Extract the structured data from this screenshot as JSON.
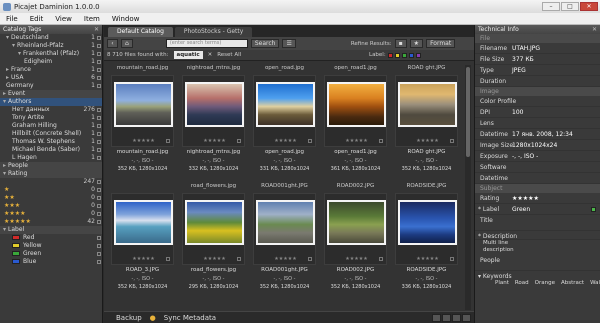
{
  "window": {
    "title": "Picajet Daminion 1.0.0.0"
  },
  "menu": [
    "File",
    "Edit",
    "View",
    "Item",
    "Window"
  ],
  "left_panel": {
    "header": "Catalog Tags",
    "tree": [
      {
        "label": "Deutschland",
        "count": "1",
        "indent": 1,
        "tri": "▾"
      },
      {
        "label": "Rheinland-Pfalz",
        "count": "1",
        "indent": 2,
        "tri": "▾"
      },
      {
        "label": "Frankenthal (Pfalz)",
        "count": "1",
        "indent": 3,
        "tri": "▾"
      },
      {
        "label": "Edigheim",
        "count": "1",
        "indent": 4,
        "tri": ""
      },
      {
        "label": "France",
        "count": "1",
        "indent": 1,
        "tri": "▸"
      },
      {
        "label": "USA",
        "count": "6",
        "indent": 1,
        "tri": "▸"
      },
      {
        "label": "Germany",
        "count": "1",
        "indent": 1,
        "tri": ""
      }
    ],
    "event_label": "Event",
    "authors_label": "Authors",
    "authors": [
      {
        "name": "Нет данных",
        "count": "276"
      },
      {
        "name": "Tony Artite",
        "count": "1"
      },
      {
        "name": "Graham Hilling",
        "count": "1"
      },
      {
        "name": "Hillbilt (Concrete Shell)",
        "count": "1"
      },
      {
        "name": "Thomas W. Stephens",
        "count": "1"
      },
      {
        "name": "Michael Benda (Saber)",
        "count": "1"
      },
      {
        "name": "L Hagen",
        "count": "1"
      }
    ],
    "people_label": "People",
    "rating_label": "Rating",
    "ratings": [
      {
        "stars": "",
        "count": "247"
      },
      {
        "stars": "★",
        "count": "0"
      },
      {
        "stars": "★★",
        "count": "0"
      },
      {
        "stars": "★★★",
        "count": "0"
      },
      {
        "stars": "★★★★",
        "count": "0"
      },
      {
        "stars": "★★★★★",
        "count": "42"
      }
    ],
    "label_header": "Label",
    "labels": [
      {
        "name": "Red",
        "color": "#d02a2a"
      },
      {
        "name": "Yellow",
        "color": "#e0cc2a"
      },
      {
        "name": "Green",
        "color": "#3aa83a"
      },
      {
        "name": "Blue",
        "color": "#2a5ad0"
      }
    ]
  },
  "center": {
    "tabs": [
      "Default Catalog",
      "PhotoStocks - Getty"
    ],
    "search_placeholder": "(enter search terms)",
    "search_button": "Search",
    "refine_label": "Refine Results:",
    "format_button": "Format",
    "files_found": "8 710 files found with:",
    "filter_chip": "aquatic",
    "reset_label": "Reset All",
    "label_caption": "Label:",
    "label_dots": [
      "#d02a2a",
      "#e0cc2a",
      "#3aa83a",
      "#2a5ad0",
      "#8a3ab0"
    ],
    "thumbnails": [
      {
        "top_name": "mountain_road.jpg",
        "name": "mountain_road.jpg",
        "meta": "-, -, ISO -",
        "size": "352 КБ, 1280x1024",
        "palette": "p1"
      },
      {
        "top_name": "nightroad_mtns.jpg",
        "name": "nightroad_mtns.jpg",
        "meta": "-, -, ISO -",
        "size": "332 КБ, 1280x1024",
        "palette": "p2"
      },
      {
        "top_name": "open_road.jpg",
        "name": "open_road.jpg",
        "meta": "-, -, ISO -",
        "size": "331 КБ, 1280x1024",
        "palette": "p3"
      },
      {
        "top_name": "open_road1.jpg",
        "name": "open_road1.jpg",
        "meta": "-, -, ISO -",
        "size": "361 КБ, 1280x1024",
        "palette": "p4"
      },
      {
        "top_name": "ROAD ght.JPG",
        "name": "ROAD ght.JPG",
        "meta": "-, -, ISO -",
        "size": "352 КБ, 1280x1024",
        "palette": "p5"
      },
      {
        "top_name": "",
        "name": "ROAD_3.JPG",
        "meta": "-, -, ISO -",
        "size": "352 КБ, 1280x1024",
        "palette": "p6"
      },
      {
        "top_name": "road_flowers.jpg",
        "name": "road_flowers.jpg",
        "meta": "-, -, ISO -",
        "size": "295 КБ, 1280x1024",
        "palette": "p7"
      },
      {
        "top_name": "ROAD001ght.JPG",
        "name": "ROAD001ght.JPG",
        "meta": "-, -, ISO -",
        "size": "352 КБ, 1280x1024",
        "palette": "p8"
      },
      {
        "top_name": "ROAD002.JPG",
        "name": "ROAD002.JPG",
        "meta": "-, -, ISO -",
        "size": "352 КБ, 1280x1024",
        "palette": "p9"
      },
      {
        "top_name": "ROADSIDE.JPG",
        "name": "ROADSIDE.JPG",
        "meta": "-, -, ISO -",
        "size": "336 КБ, 1280x1024",
        "palette": "p10"
      }
    ],
    "status": {
      "backup": "Backup",
      "sync": "Sync Metadata"
    }
  },
  "right_panel": {
    "header": "Technical Info",
    "file_section": "File",
    "file_rows": [
      {
        "k": "Filename",
        "v": "UTAH.JPG"
      },
      {
        "k": "File Size",
        "v": "377 КБ"
      },
      {
        "k": "Type",
        "v": "JPEG"
      },
      {
        "k": "Duration",
        "v": ""
      }
    ],
    "image_section": "Image",
    "image_rows": [
      {
        "k": "Color Profile",
        "v": ""
      },
      {
        "k": "DPI",
        "v": "100"
      },
      {
        "k": "Lens",
        "v": ""
      },
      {
        "k": "Datetime",
        "v": "17 янв. 2008, 12:34"
      },
      {
        "k": "Image Size",
        "v": "1280x1024x24"
      },
      {
        "k": "Exposure",
        "v": "-, -, ISO -"
      },
      {
        "k": "Software",
        "v": ""
      },
      {
        "k": "Datetime",
        "v": ""
      }
    ],
    "subject_section": "Subject",
    "rating_label": "Rating",
    "rating_stars": "★★★★★",
    "label_k": "Label",
    "label_v": "Green",
    "title_k": "Title",
    "description_k": "Description",
    "description_v": "Multi line description",
    "people_k": "People",
    "keywords_k": "Keywords",
    "keywords": [
      "Plant",
      "Road",
      "Orange",
      "Abstract",
      "Wallpaper"
    ]
  }
}
